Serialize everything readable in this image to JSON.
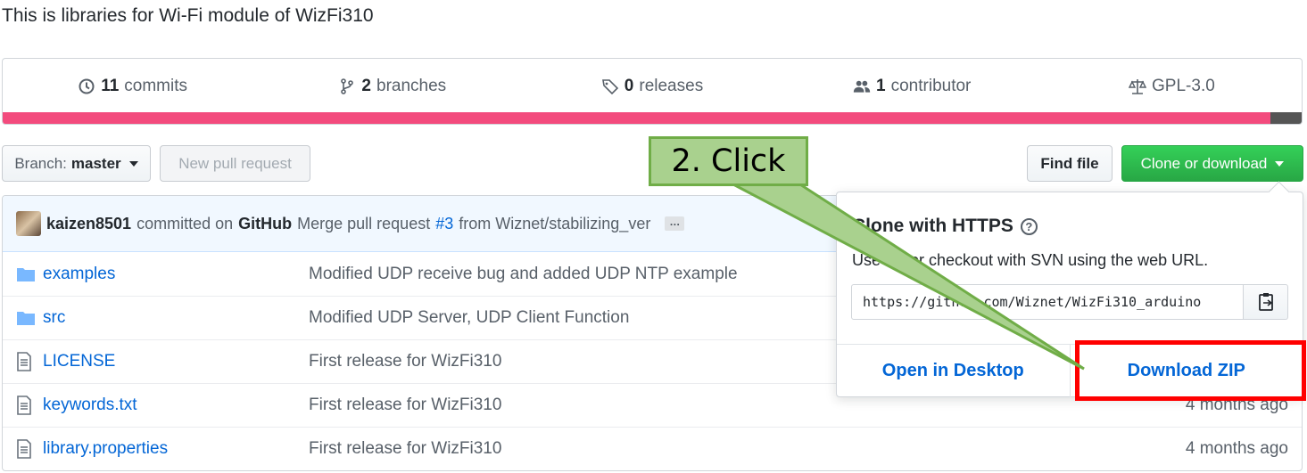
{
  "repo": {
    "description": "This is libraries for Wi-Fi module of WizFi310"
  },
  "summary": {
    "commits": {
      "count": "11",
      "label": "commits"
    },
    "branches": {
      "count": "2",
      "label": "branches"
    },
    "releases": {
      "count": "0",
      "label": "releases"
    },
    "contributors": {
      "count": "1",
      "label": "contributor"
    },
    "license": "GPL-3.0"
  },
  "language_bar": {
    "colors": [
      "#f34b7d",
      "#555555"
    ]
  },
  "toolbar": {
    "branch_label": "Branch:",
    "branch_value": "master",
    "new_pr_label": "New pull request",
    "find_file_label": "Find file",
    "clone_label": "Clone or download"
  },
  "commit": {
    "author": "kaizen8501",
    "action": "committed on",
    "platform": "GitHub",
    "message_prefix": "Merge pull request",
    "pr_link": "#3",
    "message_suffix": "from Wiznet/stabilizing_ver",
    "ellipsis": "…"
  },
  "files": [
    {
      "type": "folder",
      "icon": "folder-icon",
      "name": "examples",
      "message": "Modified UDP receive bug and added UDP NTP example",
      "age": ""
    },
    {
      "type": "folder",
      "icon": "folder-icon",
      "name": "src",
      "message": "Modified UDP Server, UDP Client Function",
      "age": ""
    },
    {
      "type": "file",
      "icon": "file-icon",
      "name": "LICENSE",
      "message": "First release for WizFi310",
      "age": ""
    },
    {
      "type": "file",
      "icon": "file-icon",
      "name": "keywords.txt",
      "message": "First release for WizFi310",
      "age": "4 months ago"
    },
    {
      "type": "file",
      "icon": "file-icon",
      "name": "library.properties",
      "message": "First release for WizFi310",
      "age": "4 months ago"
    }
  ],
  "clone_popover": {
    "title": "Clone with HTTPS",
    "help": "?",
    "description": "Use Git or checkout with SVN using the web URL.",
    "url": "https://github.com/Wiznet/WizFi310_arduino",
    "open_desktop_label": "Open in Desktop",
    "download_zip_label": "Download ZIP"
  },
  "annotation": {
    "callout_text": "2. Click",
    "highlight_color": "#ff0000",
    "callout_fill": "#a9d18e",
    "callout_border": "#70ad47"
  },
  "colors": {
    "link": "#0366d6",
    "green_button": "#28a745"
  }
}
